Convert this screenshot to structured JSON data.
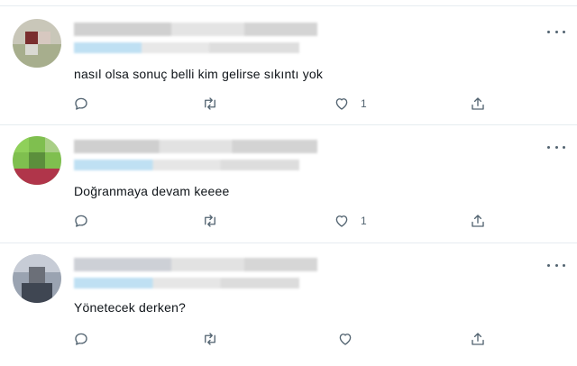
{
  "replies": [
    {
      "text": "nasıl olsa sonuç belli kim gelirse sıkıntı yok",
      "like_count": "1"
    },
    {
      "text": "Doğranmaya devam keeee",
      "like_count": "1"
    },
    {
      "text": "Yönetecek derken?",
      "like_count": ""
    }
  ],
  "icons": {
    "reply": "reply-icon",
    "retweet": "retweet-icon",
    "like": "heart-icon",
    "share": "share-icon",
    "more": "more-icon"
  },
  "colors": {
    "text": "#0f1419",
    "icon": "#536471",
    "separator": "#e6ecf0"
  }
}
